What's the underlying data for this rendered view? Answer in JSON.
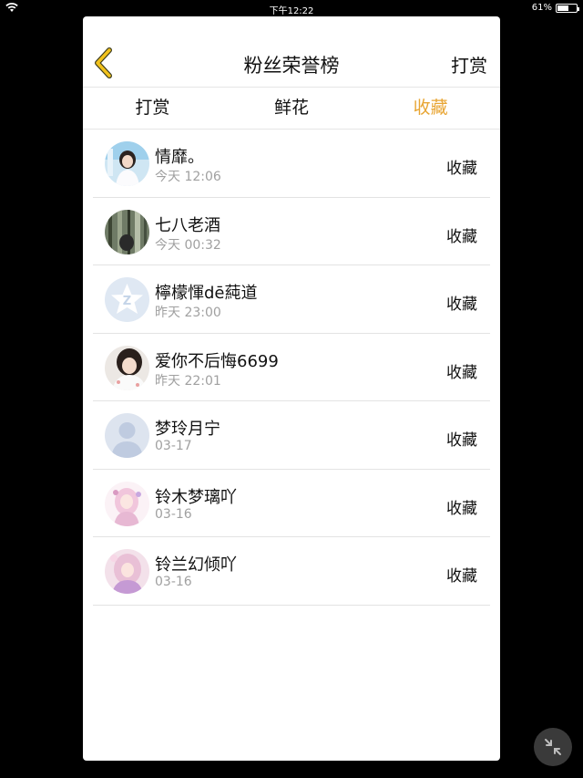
{
  "status_bar": {
    "time": "下午12:22",
    "battery": "61%",
    "battery_level": 0.61
  },
  "header": {
    "title": "粉丝荣誉榜",
    "action_label": "打赏",
    "back_icon": "chevron-left-icon"
  },
  "tabs": [
    {
      "label": "打赏",
      "active": false
    },
    {
      "label": "鲜花",
      "active": false
    },
    {
      "label": "收藏",
      "active": true
    }
  ],
  "accent_color": "#e8a533",
  "rows": [
    {
      "name": "情靡。",
      "time": "今天 12:06",
      "action": "收藏",
      "avatar": "avatar-photo-girl-blue"
    },
    {
      "name": "七八老酒",
      "time": "今天 00:32",
      "action": "收藏",
      "avatar": "avatar-photo-bamboo"
    },
    {
      "name": "檸檬惲dē蒓道",
      "time": "昨天 23:00",
      "action": "收藏",
      "avatar": "avatar-qzone-default"
    },
    {
      "name": "爱你不后悔6699",
      "time": "昨天 22:01",
      "action": "收藏",
      "avatar": "avatar-photo-girl"
    },
    {
      "name": "梦玲月宁",
      "time": "03-17",
      "action": "收藏",
      "avatar": "avatar-default-person"
    },
    {
      "name": "铃木梦璃吖",
      "time": "03-16",
      "action": "收藏",
      "avatar": "avatar-anime-pink"
    },
    {
      "name": "铃兰幻倾吖",
      "time": "03-16",
      "action": "收藏",
      "avatar": "avatar-anime-pink-2"
    }
  ],
  "floating_button_icon": "minimize-arrows-icon"
}
